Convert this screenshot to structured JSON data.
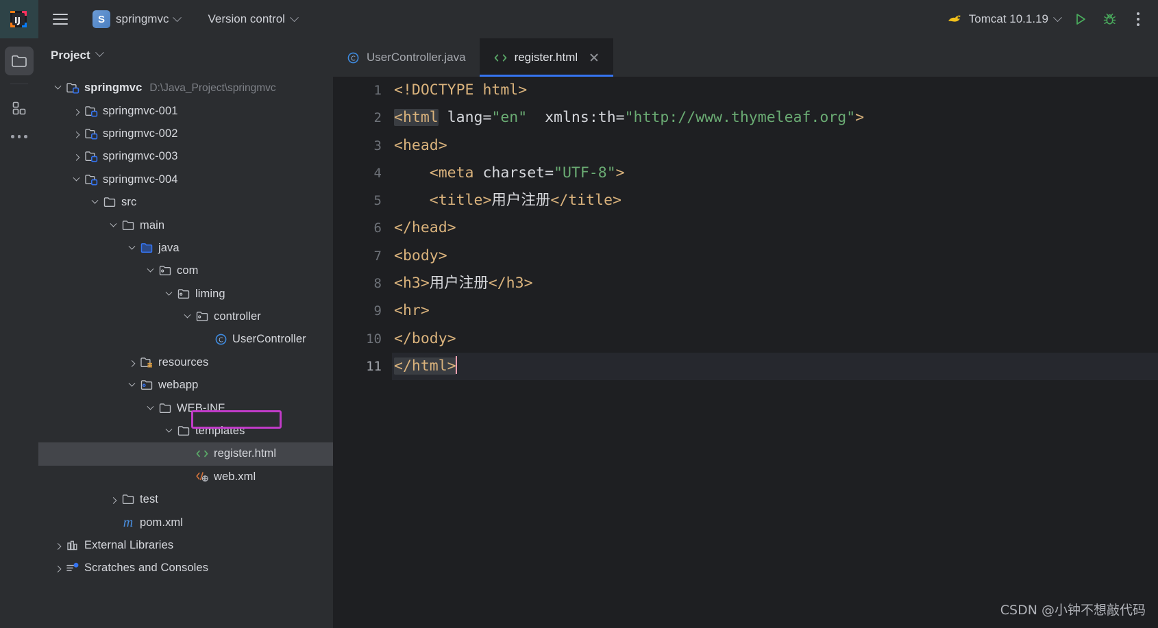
{
  "titlebar": {
    "logo_icon": "intellij-idea-logo",
    "menu_icon": "hamburger-menu-icon",
    "project_badge": "S",
    "project_name": "springmvc",
    "version_control": "Version control",
    "run_config": "Tomcat 10.1.19",
    "run_config_icon": "tomcat-icon",
    "run_icon": "run-play-icon",
    "debug_icon": "debug-bug-icon",
    "more_icon": "more-vertical-icon"
  },
  "rail": {
    "project_icon": "folder-icon",
    "structure_icon": "structure-grid-icon",
    "more_icon": "more-horizontal-icon"
  },
  "project_panel": {
    "title": "Project",
    "dropdown_icon": "chevron-down-icon",
    "tree": [
      {
        "label": "springmvc",
        "path": "D:\\Java_Project\\springmvc",
        "indent": 0,
        "state": "open",
        "icon": "module-folder-icon",
        "bold": true
      },
      {
        "label": "springmvc-001",
        "path": "",
        "indent": 1,
        "state": "closed",
        "icon": "module-folder-icon"
      },
      {
        "label": "springmvc-002",
        "path": "",
        "indent": 1,
        "state": "closed",
        "icon": "module-folder-icon"
      },
      {
        "label": "springmvc-003",
        "path": "",
        "indent": 1,
        "state": "closed",
        "icon": "module-folder-icon"
      },
      {
        "label": "springmvc-004",
        "path": "",
        "indent": 1,
        "state": "open",
        "icon": "module-folder-icon"
      },
      {
        "label": "src",
        "path": "",
        "indent": 2,
        "state": "open",
        "icon": "folder-icon"
      },
      {
        "label": "main",
        "path": "",
        "indent": 3,
        "state": "open",
        "icon": "folder-icon"
      },
      {
        "label": "java",
        "path": "",
        "indent": 4,
        "state": "open",
        "icon": "source-root-folder-icon"
      },
      {
        "label": "com",
        "path": "",
        "indent": 5,
        "state": "open",
        "icon": "package-folder-icon"
      },
      {
        "label": "liming",
        "path": "",
        "indent": 6,
        "state": "open",
        "icon": "package-folder-icon"
      },
      {
        "label": "controller",
        "path": "",
        "indent": 7,
        "state": "open",
        "icon": "package-folder-icon"
      },
      {
        "label": "UserController",
        "path": "",
        "indent": 8,
        "state": "leaf",
        "icon": "java-class-icon"
      },
      {
        "label": "resources",
        "path": "",
        "indent": 4,
        "state": "closed",
        "icon": "resources-folder-icon"
      },
      {
        "label": "webapp",
        "path": "",
        "indent": 4,
        "state": "open",
        "icon": "webapp-folder-icon"
      },
      {
        "label": "WEB-INF",
        "path": "",
        "indent": 5,
        "state": "open",
        "icon": "folder-icon"
      },
      {
        "label": "templates",
        "path": "",
        "indent": 6,
        "state": "open",
        "icon": "folder-icon"
      },
      {
        "label": "register.html",
        "path": "",
        "indent": 7,
        "state": "leaf",
        "icon": "html-file-icon",
        "selected": true,
        "highlighted": true
      },
      {
        "label": "web.xml",
        "path": "",
        "indent": 7,
        "state": "leaf",
        "icon": "xml-web-file-icon"
      },
      {
        "label": "test",
        "path": "",
        "indent": 3,
        "state": "closed",
        "icon": "folder-icon"
      },
      {
        "label": "pom.xml",
        "path": "",
        "indent": 3,
        "state": "leaf",
        "icon": "maven-pom-icon"
      },
      {
        "label": "External Libraries",
        "path": "",
        "indent": 0,
        "state": "closed",
        "icon": "libraries-icon"
      },
      {
        "label": "Scratches and Consoles",
        "path": "",
        "indent": 0,
        "state": "closed",
        "icon": "scratches-icon"
      }
    ]
  },
  "editor": {
    "tabs": [
      {
        "label": "UserController.java",
        "icon": "java-class-icon",
        "active": false,
        "closable": false
      },
      {
        "label": "register.html",
        "icon": "html-file-icon",
        "active": true,
        "closable": true
      }
    ],
    "close_icon": "close-icon",
    "caret_line": 11,
    "line_numbers": [
      "1",
      "2",
      "3",
      "4",
      "5",
      "6",
      "7",
      "8",
      "9",
      "10",
      "11"
    ],
    "code_lines": [
      {
        "n": 1,
        "tokens": [
          {
            "t": "tag",
            "v": "<!DOCTYPE html>"
          }
        ]
      },
      {
        "n": 2,
        "tokens": [
          {
            "t": "tag-hl",
            "v": "<html"
          },
          {
            "t": "plain",
            "v": " "
          },
          {
            "t": "attr",
            "v": "lang="
          },
          {
            "t": "val",
            "v": "\"en\""
          },
          {
            "t": "plain",
            "v": "  "
          },
          {
            "t": "attr",
            "v": "xmlns:th="
          },
          {
            "t": "val",
            "v": "\"http://www.thymeleaf.org\""
          },
          {
            "t": "tag",
            "v": ">"
          }
        ]
      },
      {
        "n": 3,
        "tokens": [
          {
            "t": "tag",
            "v": "<head>"
          }
        ]
      },
      {
        "n": 4,
        "tokens": [
          {
            "t": "plain",
            "v": "    "
          },
          {
            "t": "tag",
            "v": "<meta"
          },
          {
            "t": "plain",
            "v": " "
          },
          {
            "t": "attr",
            "v": "charset="
          },
          {
            "t": "val",
            "v": "\"UTF-8\""
          },
          {
            "t": "tag",
            "v": ">"
          }
        ]
      },
      {
        "n": 5,
        "tokens": [
          {
            "t": "plain",
            "v": "    "
          },
          {
            "t": "tag",
            "v": "<title>"
          },
          {
            "t": "text",
            "v": "用户注册"
          },
          {
            "t": "tag",
            "v": "</title>"
          }
        ]
      },
      {
        "n": 6,
        "tokens": [
          {
            "t": "tag",
            "v": "</head>"
          }
        ]
      },
      {
        "n": 7,
        "tokens": [
          {
            "t": "tag",
            "v": "<body>"
          }
        ]
      },
      {
        "n": 8,
        "tokens": [
          {
            "t": "tag",
            "v": "<h3>"
          },
          {
            "t": "text",
            "v": "用户注册"
          },
          {
            "t": "tag",
            "v": "</h3>"
          }
        ]
      },
      {
        "n": 9,
        "tokens": [
          {
            "t": "tag",
            "v": "<hr>"
          }
        ]
      },
      {
        "n": 10,
        "tokens": [
          {
            "t": "tag",
            "v": "</body>"
          }
        ]
      },
      {
        "n": 11,
        "tokens": [
          {
            "t": "tag-hl",
            "v": "</html>"
          },
          {
            "t": "caret",
            "v": ""
          }
        ],
        "caret": true
      }
    ]
  },
  "watermark": "CSDN @小钟不想敲代码",
  "colors": {
    "toolbar_bg": "#2b2d30",
    "editor_bg": "#1e1f22",
    "accent_blue": "#3574f0",
    "tag_orange": "#d9b27c",
    "value_green": "#6aab73",
    "highlight_magenta": "#c13bc8",
    "caret_pink": "#f5a0b0",
    "selection_gray": "#43454a"
  }
}
